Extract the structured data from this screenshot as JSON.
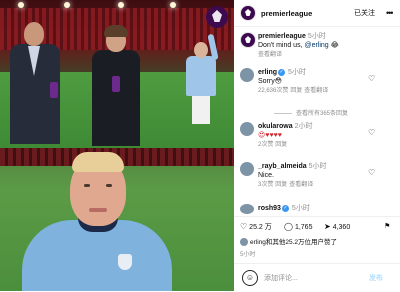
{
  "header": {
    "username": "premierleague",
    "follow_label": "已关注",
    "more_icon": "more-horizontal-icon"
  },
  "caption": {
    "username": "premierleague",
    "time": "5小时",
    "text_before": "Don't mind us, ",
    "mention": "@erling",
    "emoji": "😂",
    "translate": "查看翻译"
  },
  "comments": [
    {
      "username": "erling",
      "verified": true,
      "time": "5小时",
      "text": "Sorry😳",
      "likes": "22,636次赞",
      "reply_label": "回复",
      "translate": "查看翻译",
      "view_replies": "查看所有365条回复"
    },
    {
      "username": "okularowa",
      "verified": false,
      "time": "2小时",
      "text": "😍♥♥♥♥",
      "likes": "2次赞",
      "reply_label": "回复"
    },
    {
      "username": "_rayb_almeida",
      "verified": false,
      "time": "5小时",
      "text": "Nice.",
      "likes": "3次赞",
      "reply_label": "回复",
      "translate": "查看翻译"
    },
    {
      "username": "rosh93",
      "verified": true,
      "time": "5小时"
    }
  ],
  "actions": {
    "likes_count": "25.2 万",
    "comments_count": "1,765",
    "shares_count": "4,360"
  },
  "liked_by": "erling和其他25.2万位用户赞了",
  "post_time": "5小时",
  "add_comment_placeholder": "添加评论...",
  "post_label": "发布",
  "colors": {
    "verified": "#3897f0",
    "link": "#00376b",
    "secondary": "#8e8e8e",
    "pl_purple": "#3d0a50"
  }
}
